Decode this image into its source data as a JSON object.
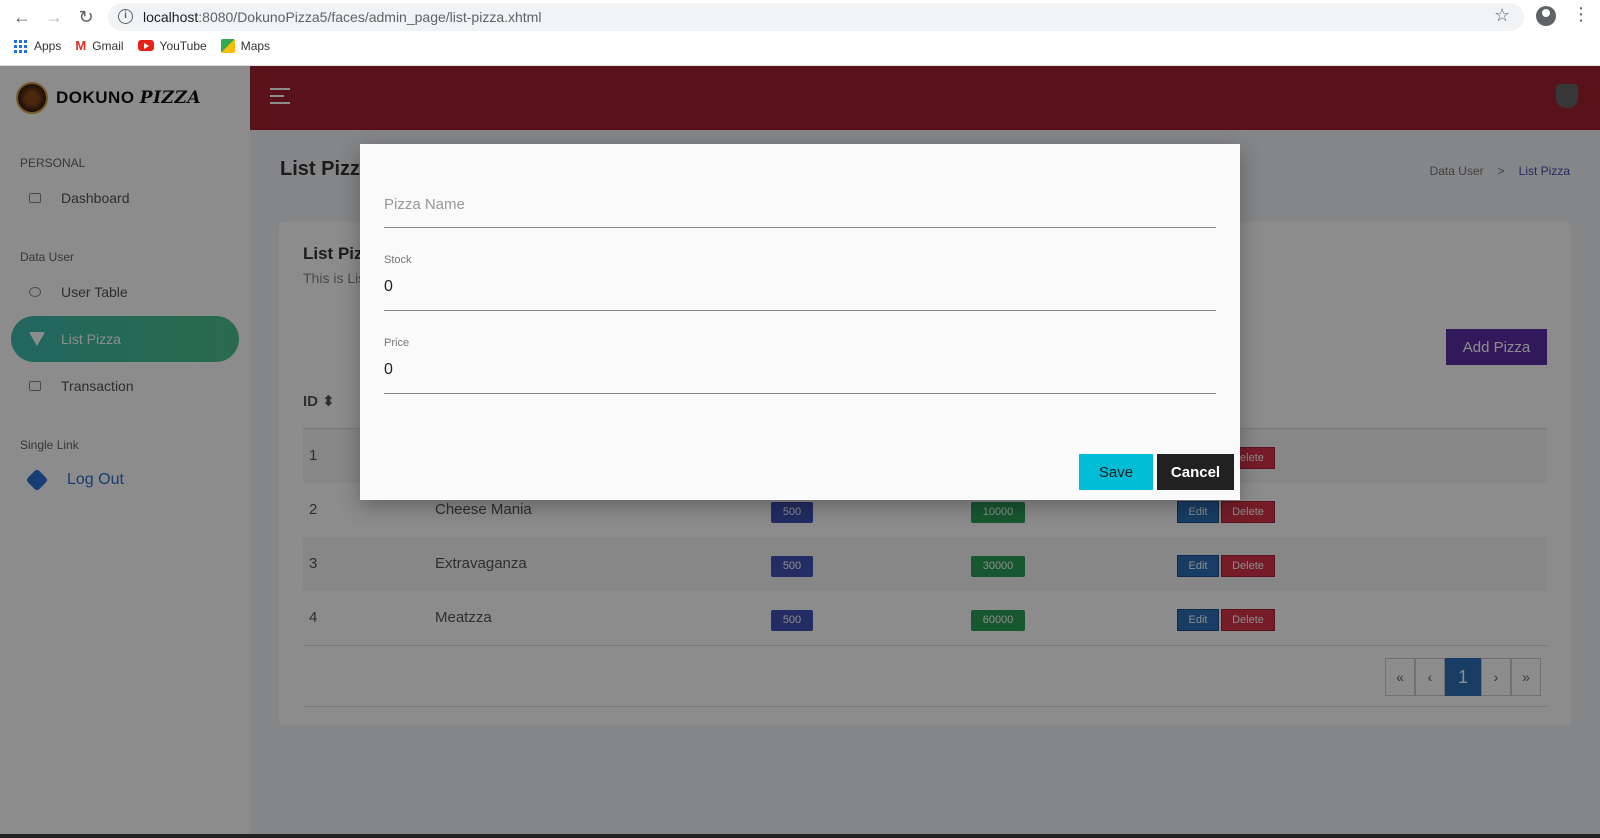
{
  "browser": {
    "url_host": "localhost",
    "url_path": ":8080/DokunoPizza5/faces/admin_page/list-pizza.xhtml",
    "bookmarks": [
      "Apps",
      "Gmail",
      "YouTube",
      "Maps"
    ]
  },
  "brand": {
    "name_main": "DOKUNO",
    "name_italic": "PIZZA"
  },
  "sidebar": {
    "sections": {
      "personal": "PERSONAL",
      "data_user": "Data User",
      "single_link": "Single Link"
    },
    "items": {
      "dashboard": "Dashboard",
      "user_table": "User Table",
      "list_pizza": "List Pizza",
      "transaction": "Transaction",
      "logout": "Log Out"
    }
  },
  "page": {
    "title": "List Pizza",
    "breadcrumb": [
      "Data User",
      ">",
      "List Pizza"
    ],
    "card_title": "List Pizza",
    "card_subtitle": "This is List Pizza",
    "add_button": "Add Pizza"
  },
  "table": {
    "header_id": "ID",
    "rows": [
      {
        "id": "1",
        "name": "",
        "stock": "",
        "price": ""
      },
      {
        "id": "2",
        "name": "Cheese Mania",
        "stock": "500",
        "price": "10000"
      },
      {
        "id": "3",
        "name": "Extravaganza",
        "stock": "500",
        "price": "30000"
      },
      {
        "id": "4",
        "name": "Meatzza",
        "stock": "500",
        "price": "60000"
      }
    ],
    "edit_label": "Edit",
    "delete_label": "Delete"
  },
  "pagination": {
    "first": "«",
    "prev": "‹",
    "current": "1",
    "next": "›",
    "last": "»"
  },
  "modal": {
    "pizza_name_placeholder": "Pizza Name",
    "stock_label": "Stock",
    "stock_value": "0",
    "price_label": "Price",
    "price_value": "0",
    "save_label": "Save",
    "cancel_label": "Cancel"
  },
  "colors": {
    "topbar": "#a32030",
    "active_nav": "#3dbbb0",
    "add_button": "#5a2ea6",
    "save_button": "#00bcd4",
    "cancel_button": "#212121"
  }
}
